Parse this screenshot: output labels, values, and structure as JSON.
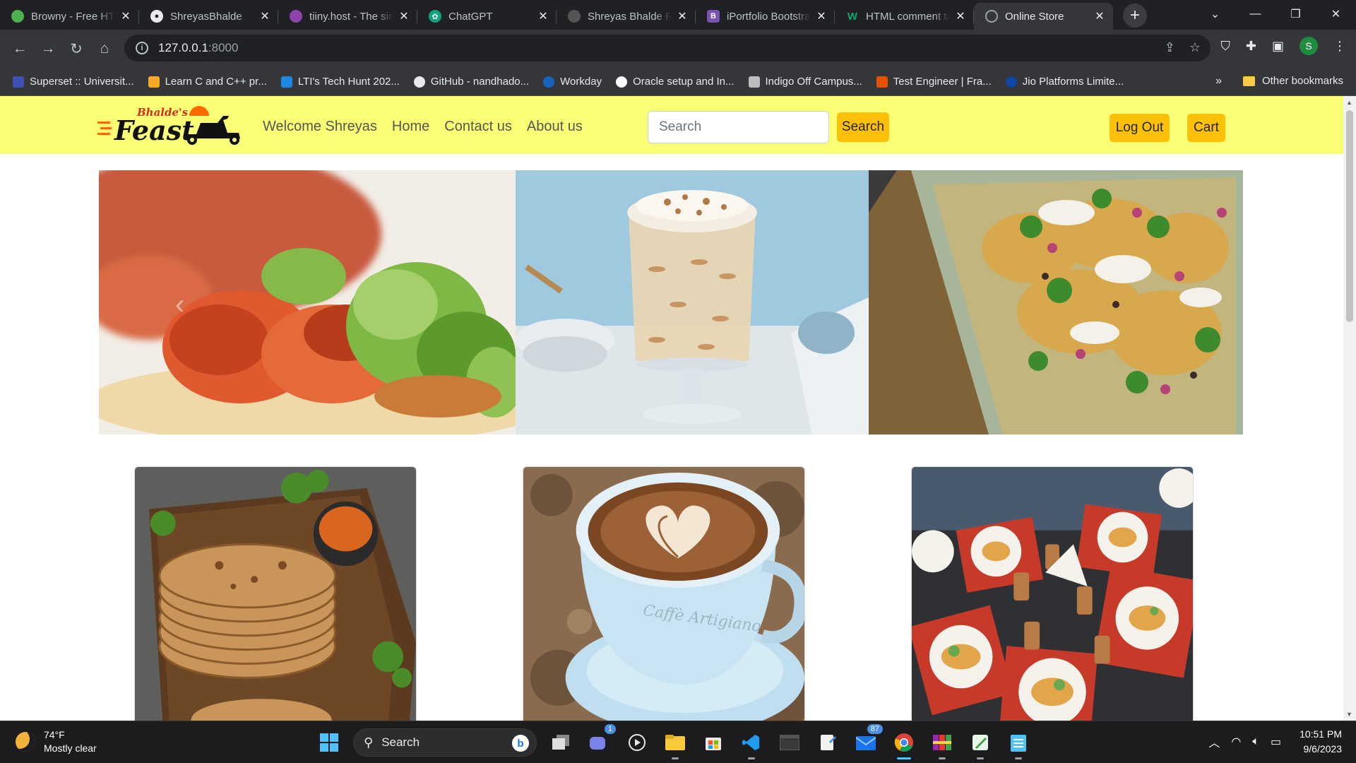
{
  "browser": {
    "tabs": [
      {
        "title": "Browny - Free HTML",
        "favicon_color": "#4caf50",
        "icon": "leaf-icon"
      },
      {
        "title": "ShreyasBhalde",
        "favicon_color": "#24292e",
        "icon": "github-icon"
      },
      {
        "title": "tiiny.host - The simplest",
        "favicon_color": "#8e44ad",
        "icon": "cloud-icon"
      },
      {
        "title": "ChatGPT",
        "favicon_color": "#10a37f",
        "icon": "chatgpt-icon"
      },
      {
        "title": "Shreyas Bhalde Resume",
        "favicon_color": "#555555",
        "icon": "globe-icon"
      },
      {
        "title": "iPortfolio Bootstrap",
        "favicon_color": "#7952b3",
        "icon": "bootstrap-icon",
        "letter": "B"
      },
      {
        "title": "HTML comment tag",
        "favicon_color": "#04aa6d",
        "icon": "w3schools-icon",
        "letter": "W"
      },
      {
        "title": "Online Store",
        "favicon_color": "#9aa0a6",
        "icon": "globe-icon",
        "active": true
      }
    ],
    "address": {
      "host": "127.0.0.1",
      "port": ":8000"
    },
    "bookmarks": [
      {
        "label": "Superset :: Universit...",
        "color": "#3f51b5"
      },
      {
        "label": "Learn C and C++ pr...",
        "color": "#f9a825"
      },
      {
        "label": "LTI's Tech Hunt 202...",
        "color": "#1e88e5"
      },
      {
        "label": "GitHub - nandhado...",
        "color": "#24292e"
      },
      {
        "label": "Workday",
        "color": "#1565c0"
      },
      {
        "label": "Oracle setup and In...",
        "color": "#ffffff"
      },
      {
        "label": "Indigo Off Campus...",
        "color": "#9e9e9e"
      },
      {
        "label": "Test Engineer | Fra...",
        "color": "#e65100"
      },
      {
        "label": "Jio Platforms Limite...",
        "color": "#0d47a1"
      }
    ],
    "bookmarks_overflow": "»",
    "other_bookmarks": "Other bookmarks",
    "profile_initial": "S"
  },
  "site": {
    "logo": {
      "script": "Bhalde's",
      "word": "Feast"
    },
    "nav": {
      "welcome": "Welcome Shreyas",
      "home": "Home",
      "contact": "Contact us",
      "about": "About us"
    },
    "search": {
      "placeholder": "Search",
      "button": "Search"
    },
    "logout": "Log Out",
    "cart": "Cart",
    "cup_text": "Caffè Artigiano"
  },
  "taskbar": {
    "weather": {
      "temp": "74°F",
      "condition": "Mostly clear"
    },
    "search_label": "Search",
    "badges": {
      "teams": "1",
      "mail": "87"
    },
    "clock": {
      "time": "10:51 PM",
      "date": "9/6/2023"
    }
  }
}
